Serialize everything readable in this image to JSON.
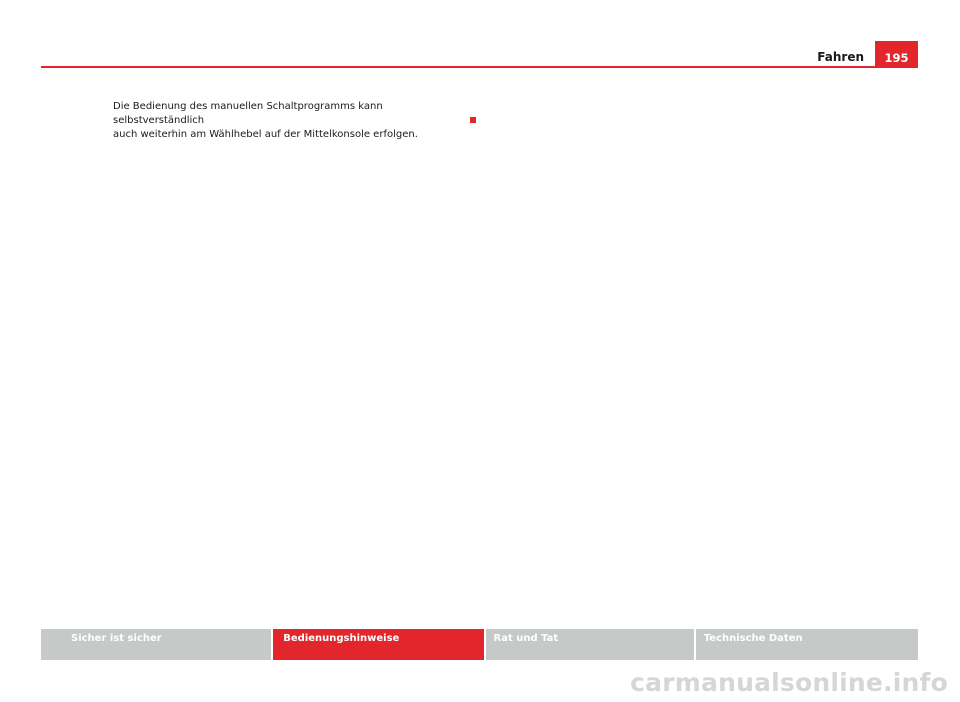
{
  "header": {
    "section_title": "Fahren",
    "page_number": "195",
    "accent_color": "#e2262c"
  },
  "body": {
    "line1": "Die Bedienung des manuellen Schaltprogramms kann selbstverständlich",
    "line2": "auch weiterhin am Wählhebel auf der Mittelkonsole erfolgen."
  },
  "footer_nav": {
    "tabs": [
      {
        "label": "Sicher ist sicher",
        "active": false
      },
      {
        "label": "Bedienungshinweise",
        "active": true
      },
      {
        "label": "Rat und Tat",
        "active": false
      },
      {
        "label": "Technische Daten",
        "active": false
      }
    ],
    "inactive_color": "#c5c9c7"
  },
  "watermark": "carmanualsonline.info"
}
